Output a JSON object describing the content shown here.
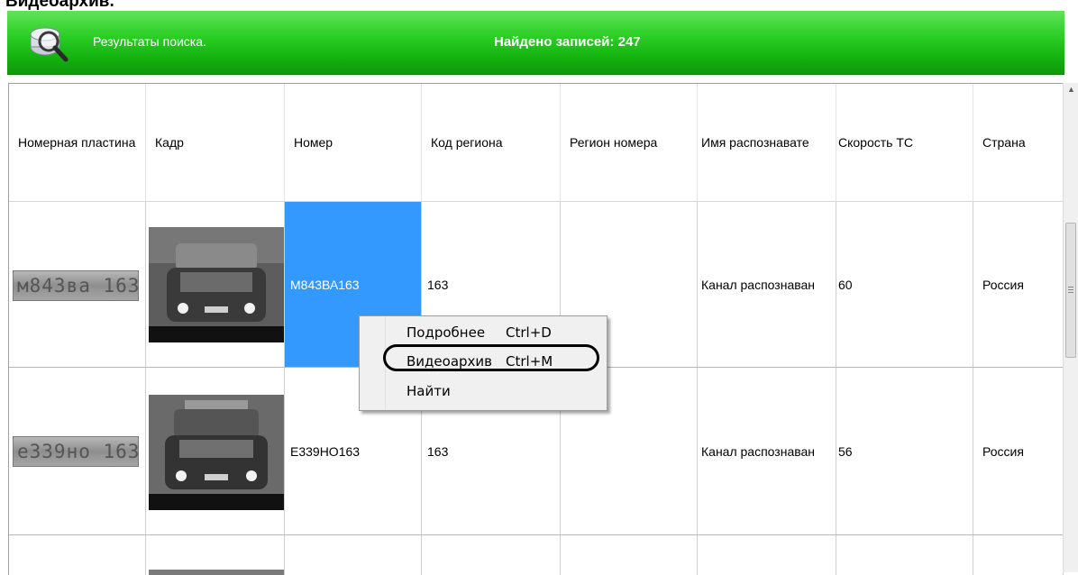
{
  "top_caption": "Видеоархив.",
  "header": {
    "title": "Результаты поиска.",
    "count_text": "Найдено записей: 247",
    "colors": {
      "bar": "#1fc01a",
      "text": "#ffffff"
    }
  },
  "table": {
    "columns": [
      "Номерная пластина",
      "Кадр",
      "Номер",
      "Код региона",
      "Регион номера",
      "Имя распознавате",
      "Скорость ТС",
      "Страна"
    ],
    "rows": [
      {
        "plate_img_text": "м843ва 163",
        "number": "М843ВА163",
        "region_code": "163",
        "region": "",
        "recognizer": "Канал распознаван",
        "speed": "60",
        "country": "Россия",
        "selected": true
      },
      {
        "plate_img_text": "е339но 163",
        "number": "Е339НО163",
        "region_code": "163",
        "region": "",
        "recognizer": "Канал распознаван",
        "speed": "56",
        "country": "Россия",
        "selected": false
      }
    ]
  },
  "context_menu": {
    "items": [
      {
        "label": "Подробнее",
        "shortcut": "Ctrl+D"
      },
      {
        "label": "Видеоархив",
        "shortcut": "Ctrl+M"
      },
      {
        "label": "Найти",
        "shortcut": ""
      }
    ],
    "highlighted_item": "Видеоархив"
  },
  "icons": {
    "header_icon": "search-magnifier-icon",
    "scroll_up": "scroll-up-arrow-icon"
  }
}
